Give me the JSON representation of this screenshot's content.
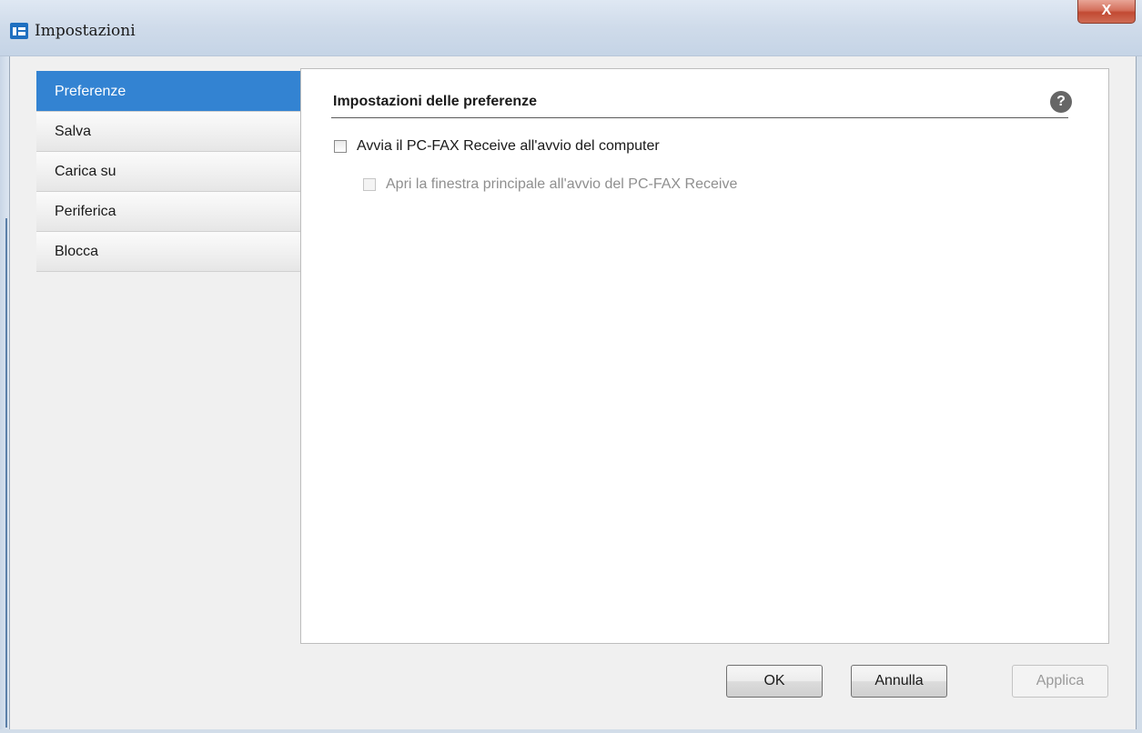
{
  "window": {
    "title": "Impostazioni",
    "close_glyph": "X",
    "app_icon": "fax-settings-icon"
  },
  "sidebar": {
    "items": [
      {
        "label": "Preferenze",
        "selected": true
      },
      {
        "label": "Salva",
        "selected": false
      },
      {
        "label": "Carica su",
        "selected": false
      },
      {
        "label": "Periferica",
        "selected": false
      },
      {
        "label": "Blocca",
        "selected": false
      }
    ]
  },
  "content": {
    "section_title": "Impostazioni delle preferenze",
    "help_glyph": "?",
    "options": [
      {
        "label": "Avvia il PC-FAX Receive all'avvio del computer",
        "checked": false,
        "enabled": true
      },
      {
        "label": "Apri la finestra principale all'avvio del PC-FAX Receive",
        "checked": false,
        "enabled": false
      }
    ]
  },
  "buttons": {
    "ok": "OK",
    "cancel": "Annulla",
    "apply": "Applica"
  },
  "colors": {
    "selection": "#3383d2",
    "close_button": "#c24a33"
  }
}
